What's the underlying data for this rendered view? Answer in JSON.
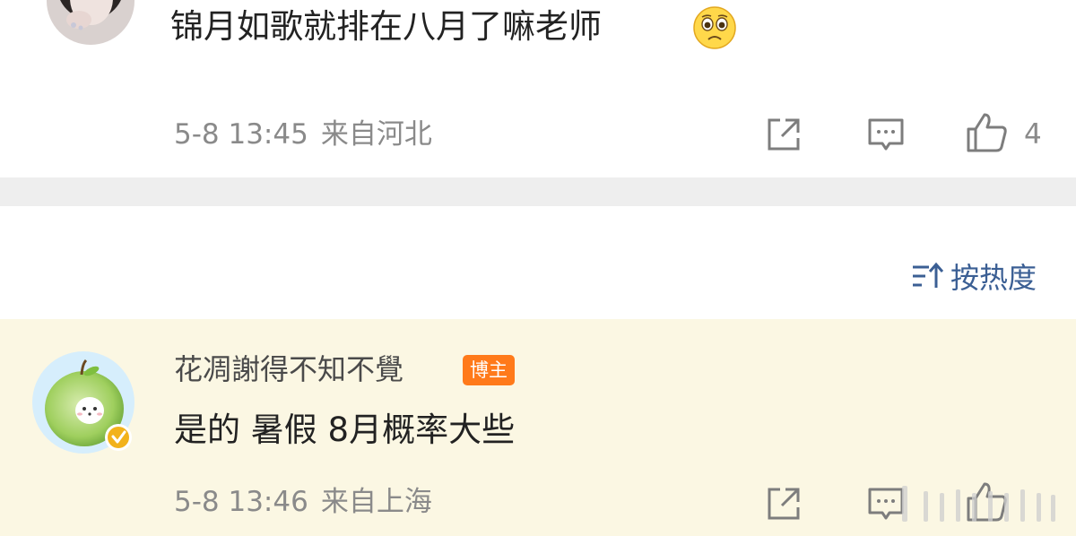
{
  "comment_1": {
    "text": "锦月如歌就排在八月了嘛老师",
    "emoji": "crying-face-emoji",
    "timestamp": "5-8 13:45",
    "location": "来自河北",
    "like_count": "4"
  },
  "sort": {
    "label": "按热度",
    "icon": "sort-icon"
  },
  "comment_2": {
    "username": "花凋謝得不知不覺",
    "badge": "博主",
    "text": "是的 暑假 8月概率大些",
    "timestamp": "5-8 13:46",
    "location": "来自上海"
  },
  "colors": {
    "sort_blue": "#3b5f94",
    "badge_orange": "#ff7a1a",
    "highlight_bg": "#fbf7e3",
    "meta_gray": "#8a8a8a",
    "verified_gold": "#f2b21b"
  }
}
